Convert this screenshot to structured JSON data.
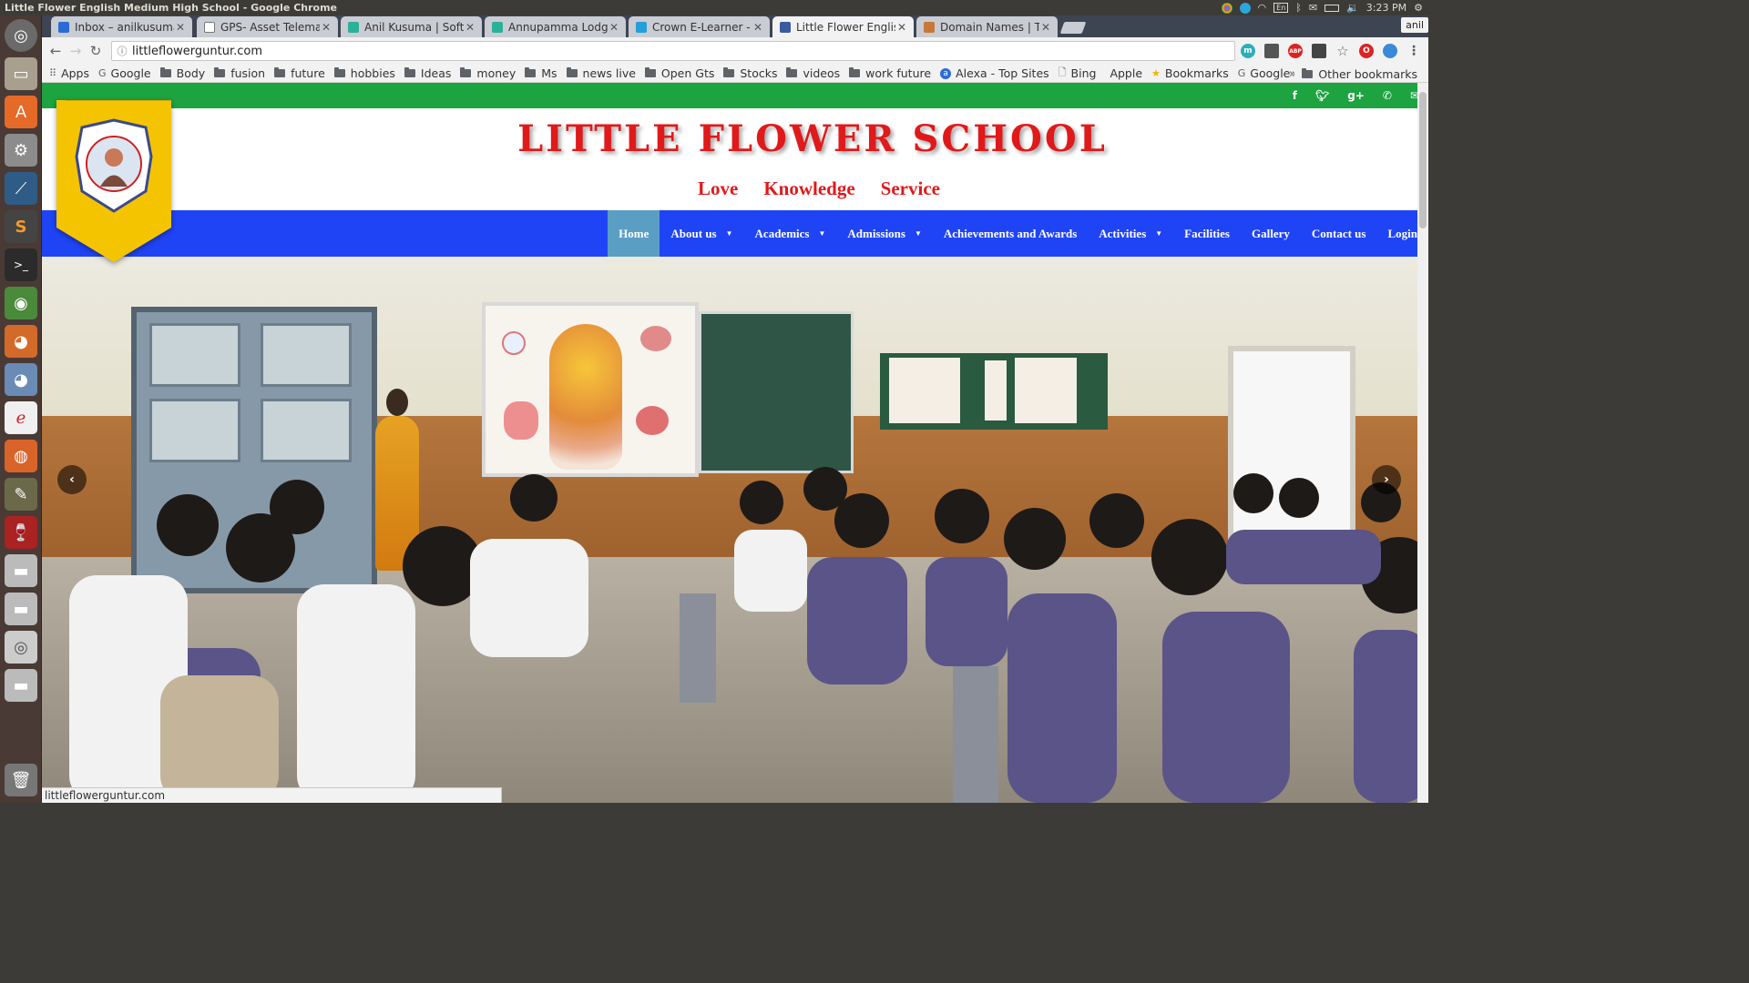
{
  "window": {
    "title": "Little Flower English Medium High School - Google Chrome"
  },
  "tray": {
    "time": "3:23 PM",
    "user": "anil"
  },
  "tabs": [
    {
      "label": "Inbox – anilkusuma",
      "color": "#2a6bd8"
    },
    {
      "label": "GPS- Asset Telemat",
      "color": "#777777"
    },
    {
      "label": "Anil Kusuma | Softw",
      "color": "#2bb09a"
    },
    {
      "label": "Annupamma Lodge",
      "color": "#2bb09a"
    },
    {
      "label": "Crown E-Learner - A",
      "color": "#23a0d8"
    },
    {
      "label": "Little Flower Englis",
      "color": "#3c5aa0"
    },
    {
      "label": "Domain Names | Th",
      "color": "#c7773a"
    }
  ],
  "active_tab_index": 5,
  "address_bar": {
    "url": "littleflowerguntur.com"
  },
  "bookmarks": [
    {
      "label": "Apps",
      "kind": "apps"
    },
    {
      "label": "Google",
      "kind": "google"
    },
    {
      "label": "Body",
      "kind": "folder"
    },
    {
      "label": "fusion",
      "kind": "folder"
    },
    {
      "label": "future",
      "kind": "folder"
    },
    {
      "label": "hobbies",
      "kind": "folder"
    },
    {
      "label": "Ideas",
      "kind": "folder"
    },
    {
      "label": "money",
      "kind": "folder"
    },
    {
      "label": "Ms",
      "kind": "folder"
    },
    {
      "label": "news live",
      "kind": "folder"
    },
    {
      "label": "Open Gts",
      "kind": "folder"
    },
    {
      "label": "Stocks",
      "kind": "folder"
    },
    {
      "label": "videos",
      "kind": "folder"
    },
    {
      "label": "work future",
      "kind": "folder"
    },
    {
      "label": "Alexa - Top Sites",
      "kind": "site"
    },
    {
      "label": "Bing",
      "kind": "page"
    },
    {
      "label": "Apple",
      "kind": "apple"
    },
    {
      "label": "Bookmarks",
      "kind": "star"
    },
    {
      "label": "Google",
      "kind": "google"
    }
  ],
  "other_bookmarks": "Other bookmarks",
  "site": {
    "title": "LITTLE FLOWER SCHOOL",
    "motto": [
      "Love",
      "Knowledge",
      "Service"
    ],
    "menu": [
      {
        "label": "Home",
        "dropdown": false,
        "active": true
      },
      {
        "label": "About us",
        "dropdown": true,
        "active": false
      },
      {
        "label": "Academics",
        "dropdown": true,
        "active": false
      },
      {
        "label": "Admissions",
        "dropdown": true,
        "active": false
      },
      {
        "label": "Achievements and Awards",
        "dropdown": false,
        "active": false
      },
      {
        "label": "Activities",
        "dropdown": true,
        "active": false
      },
      {
        "label": "Facilities",
        "dropdown": false,
        "active": false
      },
      {
        "label": "Gallery",
        "dropdown": false,
        "active": false
      },
      {
        "label": "Contact us",
        "dropdown": false,
        "active": false
      },
      {
        "label": "Login",
        "dropdown": false,
        "active": false
      }
    ],
    "social_icons": [
      "facebook-icon",
      "twitter-icon",
      "google-plus-icon",
      "phone-icon",
      "mail-icon"
    ],
    "colors": {
      "top_bar": "#1da340",
      "nav": "#1f44f5",
      "title": "#e0191a",
      "active_menu": "#5a9ec4"
    }
  },
  "status_bar": {
    "text": "littleflowerguntur.com"
  }
}
